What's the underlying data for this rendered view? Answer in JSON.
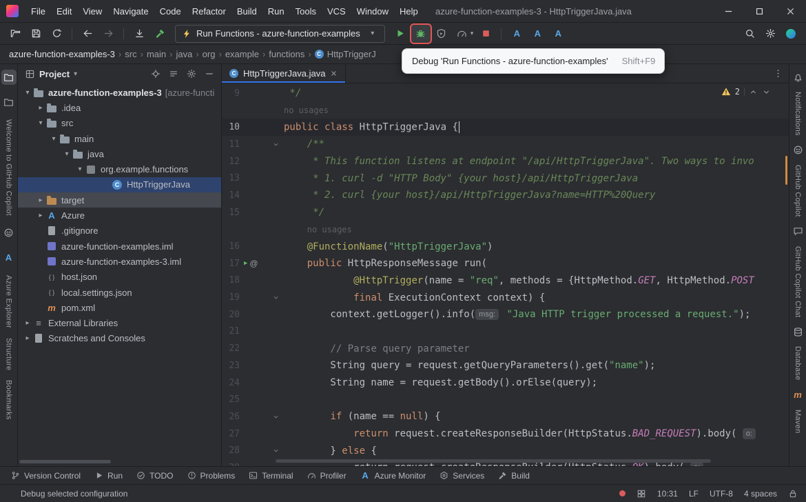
{
  "colors": {
    "accent": "#3574f0",
    "selection_blue": "#2e436e",
    "run_green": "#5cb865",
    "error_red": "#db5c5c",
    "warning_yellow": "#f2c55c",
    "debug_highlight_border": "#e45757"
  },
  "titlebar": {
    "title": "azure-function-examples-3 - HttpTriggerJava.java",
    "menu": [
      "File",
      "Edit",
      "View",
      "Navigate",
      "Code",
      "Refactor",
      "Build",
      "Run",
      "Tools",
      "VCS",
      "Window",
      "Help"
    ]
  },
  "toolbar": {
    "run_config": "Run Functions - azure-function-examples"
  },
  "tooltip": {
    "text": "Debug 'Run Functions - azure-function-examples'",
    "shortcut": "Shift+F9"
  },
  "breadcrumbs": {
    "items": [
      "azure-function-examples-3",
      "src",
      "main",
      "java",
      "org",
      "example",
      "functions",
      "HttpTriggerJ"
    ]
  },
  "left_stripe": [
    {
      "kind": "icon",
      "name": "project-tool-icon",
      "icon": "project",
      "active": true
    },
    {
      "kind": "icon",
      "name": "folder-icon",
      "icon": "folder-outline"
    },
    {
      "kind": "label",
      "name": "tool-welcome-github-copilot",
      "label": "Welcome to GitHub Copilot"
    },
    {
      "kind": "icon",
      "name": "copilot-icon",
      "icon": "copilot"
    },
    {
      "kind": "icon",
      "name": "azure-a-icon",
      "icon": "azure-a"
    },
    {
      "kind": "label",
      "name": "tool-azure-explorer",
      "label": "Azure Explorer"
    },
    {
      "kind": "label",
      "name": "tool-structure",
      "label": "Structure"
    },
    {
      "kind": "label",
      "name": "tool-bookmarks",
      "label": "Bookmarks"
    }
  ],
  "right_stripe": [
    {
      "kind": "icon",
      "name": "notifications-bell-icon",
      "icon": "bell"
    },
    {
      "kind": "label",
      "name": "tool-notifications",
      "label": "Notifications"
    },
    {
      "kind": "icon",
      "name": "github-copilot-icon",
      "icon": "copilot"
    },
    {
      "kind": "label",
      "name": "tool-github-copilot",
      "label": "GitHub Copilot"
    },
    {
      "kind": "icon",
      "name": "copilot-chat-icon",
      "icon": "chat"
    },
    {
      "kind": "label",
      "name": "tool-github-copilot-chat",
      "label": "GitHub Copilot Chat"
    },
    {
      "kind": "icon",
      "name": "database-icon",
      "icon": "database"
    },
    {
      "kind": "label",
      "name": "tool-database",
      "label": "Database"
    },
    {
      "kind": "icon",
      "name": "maven-icon",
      "icon": "maven"
    },
    {
      "kind": "label",
      "name": "tool-maven",
      "label": "Maven"
    }
  ],
  "project_panel": {
    "title": "Project",
    "tree": [
      {
        "label": "azure-function-examples-3",
        "suffix": "[azure-functi",
        "indent": 0,
        "chevron": "down",
        "icon": "folder",
        "bold": true
      },
      {
        "label": ".idea",
        "indent": 1,
        "chevron": "right",
        "icon": "folder"
      },
      {
        "label": "src",
        "indent": 1,
        "chevron": "down",
        "icon": "folder"
      },
      {
        "label": "main",
        "indent": 2,
        "chevron": "down",
        "icon": "folder"
      },
      {
        "label": "java",
        "indent": 3,
        "chevron": "down",
        "icon": "folder"
      },
      {
        "label": "org.example.functions",
        "indent": 4,
        "chevron": "down",
        "icon": "package"
      },
      {
        "label": "HttpTriggerJava",
        "indent": 6,
        "icon": "class",
        "selected": true
      },
      {
        "label": "target",
        "indent": 1,
        "chevron": "right",
        "icon": "folder-excluded",
        "highlighted": true
      },
      {
        "label": "Azure",
        "indent": 1,
        "chevron": "right",
        "icon": "azure-a"
      },
      {
        "label": ".gitignore",
        "indent": 1,
        "icon": "file"
      },
      {
        "label": "azure-function-examples.iml",
        "indent": 1,
        "icon": "module"
      },
      {
        "label": "azure-function-examples-3.iml",
        "indent": 1,
        "icon": "module"
      },
      {
        "label": "host.json",
        "indent": 1,
        "icon": "json"
      },
      {
        "label": "local.settings.json",
        "indent": 1,
        "icon": "json"
      },
      {
        "label": "pom.xml",
        "indent": 1,
        "icon": "maven"
      },
      {
        "label": "External Libraries",
        "indent": 0,
        "chevron": "right",
        "icon": "libraries"
      },
      {
        "label": "Scratches and Consoles",
        "indent": 0,
        "chevron": "right",
        "icon": "scratches"
      }
    ]
  },
  "editor": {
    "tab": {
      "label": "HttpTriggerJava.java"
    },
    "inspections": {
      "warnings": "2"
    },
    "rows": [
      {
        "n": "9",
        "t": [
          [
            " */",
            "d"
          ]
        ]
      },
      {
        "hint": "no usages",
        "ind": 0
      },
      {
        "n": "10",
        "cur": true,
        "caret": true,
        "t": [
          [
            "public class ",
            "k"
          ],
          [
            "HttpTriggerJava ",
            "p"
          ],
          [
            "{",
            "p"
          ]
        ]
      },
      {
        "n": "11",
        "fold": true,
        "t": [
          [
            "    ",
            "p"
          ],
          [
            "/**",
            "d"
          ]
        ]
      },
      {
        "n": "12",
        "t": [
          [
            "     * This function listens at endpoint \"/api/HttpTriggerJava\". Two ways to invo",
            "d"
          ]
        ]
      },
      {
        "n": "13",
        "t": [
          [
            "     * 1. curl -d \"HTTP Body\" {your host}/api/HttpTriggerJava",
            "d"
          ]
        ]
      },
      {
        "n": "14",
        "t": [
          [
            "     * 2. curl {your host}/api/HttpTriggerJava?name=HTTP%20Query",
            "d"
          ]
        ]
      },
      {
        "n": "15",
        "t": [
          [
            "     */",
            "d"
          ]
        ]
      },
      {
        "hint": "no usages",
        "ind": 4
      },
      {
        "n": "16",
        "t": [
          [
            "    ",
            "p"
          ],
          [
            "@FunctionName",
            "a"
          ],
          [
            "(",
            "p"
          ],
          [
            "\"HttpTriggerJava\"",
            "s"
          ],
          [
            ")",
            "p"
          ]
        ]
      },
      {
        "n": "17",
        "run": true,
        "t": [
          [
            "    ",
            "p"
          ],
          [
            "public ",
            "k"
          ],
          [
            "HttpResponseMessage run(",
            "p"
          ]
        ]
      },
      {
        "n": "18",
        "t": [
          [
            "            ",
            "p"
          ],
          [
            "@HttpTrigger",
            "a"
          ],
          [
            "(name = ",
            "p"
          ],
          [
            "\"req\"",
            "s"
          ],
          [
            ", methods = {HttpMethod.",
            "p"
          ],
          [
            "GET",
            "f"
          ],
          [
            ", HttpMethod.",
            "p"
          ],
          [
            "POST",
            "f"
          ]
        ]
      },
      {
        "n": "19",
        "fold": true,
        "t": [
          [
            "            ",
            "p"
          ],
          [
            "final ",
            "k"
          ],
          [
            "ExecutionContext context) {",
            "p"
          ]
        ]
      },
      {
        "n": "20",
        "t": [
          [
            "        context.getLogger().info(",
            "p"
          ],
          [
            "msg:",
            "h"
          ],
          [
            " ",
            "p"
          ],
          [
            "\"Java HTTP trigger processed a request.\"",
            "s"
          ],
          [
            ");",
            "p"
          ]
        ]
      },
      {
        "n": "21",
        "t": []
      },
      {
        "n": "22",
        "t": [
          [
            "        ",
            "p"
          ],
          [
            "// Parse query parameter",
            "c"
          ]
        ]
      },
      {
        "n": "23",
        "t": [
          [
            "        String query = request.getQueryParameters().get(",
            "p"
          ],
          [
            "\"name\"",
            "s"
          ],
          [
            ");",
            "p"
          ]
        ]
      },
      {
        "n": "24",
        "t": [
          [
            "        String name = request.getBody().orElse(query);",
            "p"
          ]
        ]
      },
      {
        "n": "25",
        "t": []
      },
      {
        "n": "26",
        "fold": true,
        "t": [
          [
            "        ",
            "p"
          ],
          [
            "if ",
            "k"
          ],
          [
            "(name == ",
            "p"
          ],
          [
            "null",
            "k"
          ],
          [
            ") {",
            "p"
          ]
        ]
      },
      {
        "n": "27",
        "t": [
          [
            "            ",
            "p"
          ],
          [
            "return ",
            "k"
          ],
          [
            "request.createResponseBuilder(HttpStatus.",
            "p"
          ],
          [
            "BAD_REQUEST",
            "f"
          ],
          [
            ").body( ",
            "p"
          ],
          [
            "o:",
            "h"
          ]
        ]
      },
      {
        "n": "28",
        "fold": true,
        "t": [
          [
            "        } ",
            "p"
          ],
          [
            "else ",
            "k"
          ],
          [
            "{",
            "p"
          ]
        ]
      },
      {
        "n": "29",
        "t": [
          [
            "            return request.createResponseBuilder(HttpStatus.",
            "p"
          ],
          [
            "OK",
            "f"
          ],
          [
            ").body( ",
            "p"
          ],
          [
            "o:",
            "h"
          ]
        ]
      }
    ]
  },
  "bottom_bar": [
    {
      "icon": "branch",
      "label": "Version Control"
    },
    {
      "icon": "play",
      "label": "Run"
    },
    {
      "icon": "todo",
      "label": "TODO"
    },
    {
      "icon": "problems",
      "label": "Problems"
    },
    {
      "icon": "terminal",
      "label": "Terminal"
    },
    {
      "icon": "gauge",
      "label": "Profiler"
    },
    {
      "icon": "azure-a",
      "label": "Azure Monitor"
    },
    {
      "icon": "services",
      "label": "Services"
    },
    {
      "icon": "hammer",
      "label": "Build"
    }
  ],
  "status_bar": {
    "left": "Debug selected configuration",
    "items": [
      "10:31",
      "LF",
      "UTF-8",
      "4 spaces"
    ]
  }
}
